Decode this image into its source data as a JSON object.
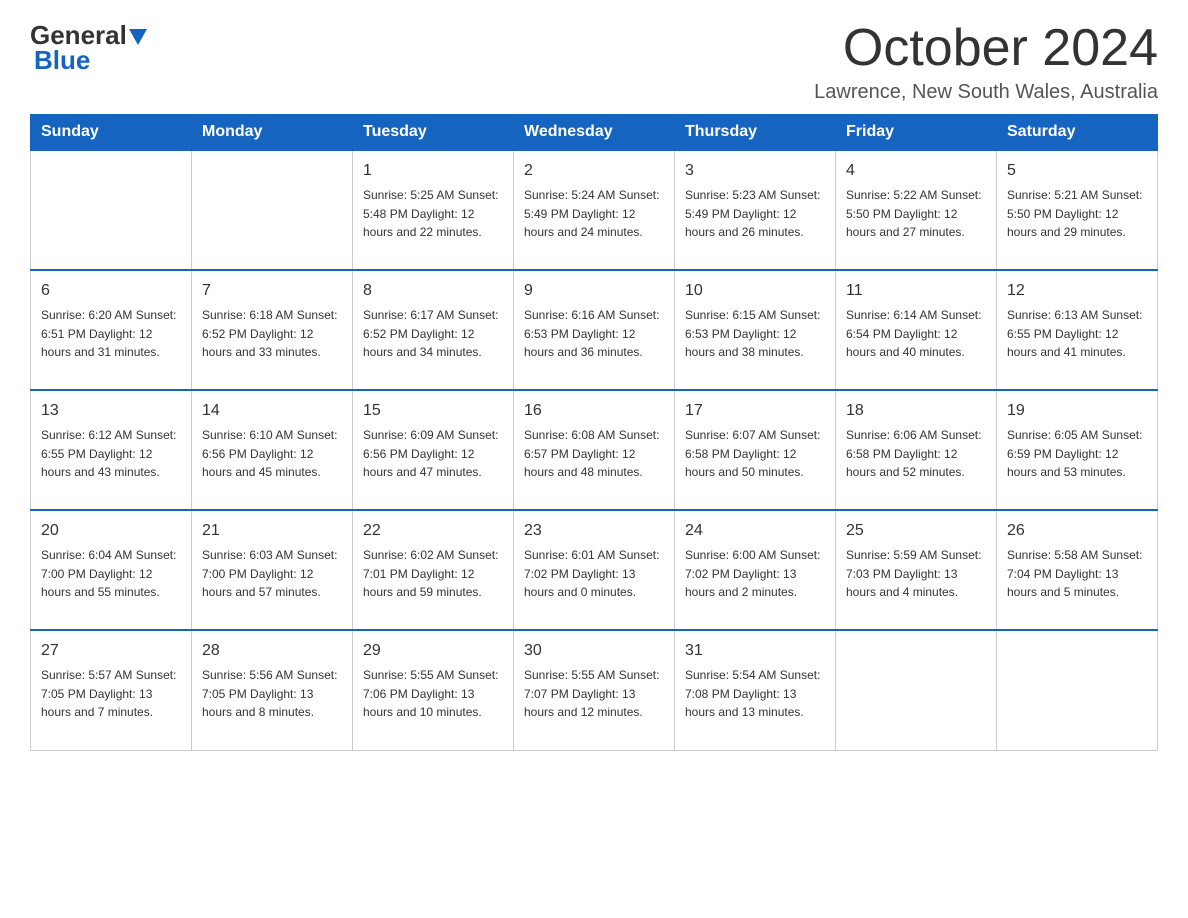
{
  "logo": {
    "general": "General",
    "blue": "Blue"
  },
  "header": {
    "month": "October 2024",
    "location": "Lawrence, New South Wales, Australia"
  },
  "days_of_week": [
    "Sunday",
    "Monday",
    "Tuesday",
    "Wednesday",
    "Thursday",
    "Friday",
    "Saturday"
  ],
  "weeks": [
    [
      {
        "day": "",
        "info": ""
      },
      {
        "day": "",
        "info": ""
      },
      {
        "day": "1",
        "info": "Sunrise: 5:25 AM\nSunset: 5:48 PM\nDaylight: 12 hours\nand 22 minutes."
      },
      {
        "day": "2",
        "info": "Sunrise: 5:24 AM\nSunset: 5:49 PM\nDaylight: 12 hours\nand 24 minutes."
      },
      {
        "day": "3",
        "info": "Sunrise: 5:23 AM\nSunset: 5:49 PM\nDaylight: 12 hours\nand 26 minutes."
      },
      {
        "day": "4",
        "info": "Sunrise: 5:22 AM\nSunset: 5:50 PM\nDaylight: 12 hours\nand 27 minutes."
      },
      {
        "day": "5",
        "info": "Sunrise: 5:21 AM\nSunset: 5:50 PM\nDaylight: 12 hours\nand 29 minutes."
      }
    ],
    [
      {
        "day": "6",
        "info": "Sunrise: 6:20 AM\nSunset: 6:51 PM\nDaylight: 12 hours\nand 31 minutes."
      },
      {
        "day": "7",
        "info": "Sunrise: 6:18 AM\nSunset: 6:52 PM\nDaylight: 12 hours\nand 33 minutes."
      },
      {
        "day": "8",
        "info": "Sunrise: 6:17 AM\nSunset: 6:52 PM\nDaylight: 12 hours\nand 34 minutes."
      },
      {
        "day": "9",
        "info": "Sunrise: 6:16 AM\nSunset: 6:53 PM\nDaylight: 12 hours\nand 36 minutes."
      },
      {
        "day": "10",
        "info": "Sunrise: 6:15 AM\nSunset: 6:53 PM\nDaylight: 12 hours\nand 38 minutes."
      },
      {
        "day": "11",
        "info": "Sunrise: 6:14 AM\nSunset: 6:54 PM\nDaylight: 12 hours\nand 40 minutes."
      },
      {
        "day": "12",
        "info": "Sunrise: 6:13 AM\nSunset: 6:55 PM\nDaylight: 12 hours\nand 41 minutes."
      }
    ],
    [
      {
        "day": "13",
        "info": "Sunrise: 6:12 AM\nSunset: 6:55 PM\nDaylight: 12 hours\nand 43 minutes."
      },
      {
        "day": "14",
        "info": "Sunrise: 6:10 AM\nSunset: 6:56 PM\nDaylight: 12 hours\nand 45 minutes."
      },
      {
        "day": "15",
        "info": "Sunrise: 6:09 AM\nSunset: 6:56 PM\nDaylight: 12 hours\nand 47 minutes."
      },
      {
        "day": "16",
        "info": "Sunrise: 6:08 AM\nSunset: 6:57 PM\nDaylight: 12 hours\nand 48 minutes."
      },
      {
        "day": "17",
        "info": "Sunrise: 6:07 AM\nSunset: 6:58 PM\nDaylight: 12 hours\nand 50 minutes."
      },
      {
        "day": "18",
        "info": "Sunrise: 6:06 AM\nSunset: 6:58 PM\nDaylight: 12 hours\nand 52 minutes."
      },
      {
        "day": "19",
        "info": "Sunrise: 6:05 AM\nSunset: 6:59 PM\nDaylight: 12 hours\nand 53 minutes."
      }
    ],
    [
      {
        "day": "20",
        "info": "Sunrise: 6:04 AM\nSunset: 7:00 PM\nDaylight: 12 hours\nand 55 minutes."
      },
      {
        "day": "21",
        "info": "Sunrise: 6:03 AM\nSunset: 7:00 PM\nDaylight: 12 hours\nand 57 minutes."
      },
      {
        "day": "22",
        "info": "Sunrise: 6:02 AM\nSunset: 7:01 PM\nDaylight: 12 hours\nand 59 minutes."
      },
      {
        "day": "23",
        "info": "Sunrise: 6:01 AM\nSunset: 7:02 PM\nDaylight: 13 hours\nand 0 minutes."
      },
      {
        "day": "24",
        "info": "Sunrise: 6:00 AM\nSunset: 7:02 PM\nDaylight: 13 hours\nand 2 minutes."
      },
      {
        "day": "25",
        "info": "Sunrise: 5:59 AM\nSunset: 7:03 PM\nDaylight: 13 hours\nand 4 minutes."
      },
      {
        "day": "26",
        "info": "Sunrise: 5:58 AM\nSunset: 7:04 PM\nDaylight: 13 hours\nand 5 minutes."
      }
    ],
    [
      {
        "day": "27",
        "info": "Sunrise: 5:57 AM\nSunset: 7:05 PM\nDaylight: 13 hours\nand 7 minutes."
      },
      {
        "day": "28",
        "info": "Sunrise: 5:56 AM\nSunset: 7:05 PM\nDaylight: 13 hours\nand 8 minutes."
      },
      {
        "day": "29",
        "info": "Sunrise: 5:55 AM\nSunset: 7:06 PM\nDaylight: 13 hours\nand 10 minutes."
      },
      {
        "day": "30",
        "info": "Sunrise: 5:55 AM\nSunset: 7:07 PM\nDaylight: 13 hours\nand 12 minutes."
      },
      {
        "day": "31",
        "info": "Sunrise: 5:54 AM\nSunset: 7:08 PM\nDaylight: 13 hours\nand 13 minutes."
      },
      {
        "day": "",
        "info": ""
      },
      {
        "day": "",
        "info": ""
      }
    ]
  ]
}
